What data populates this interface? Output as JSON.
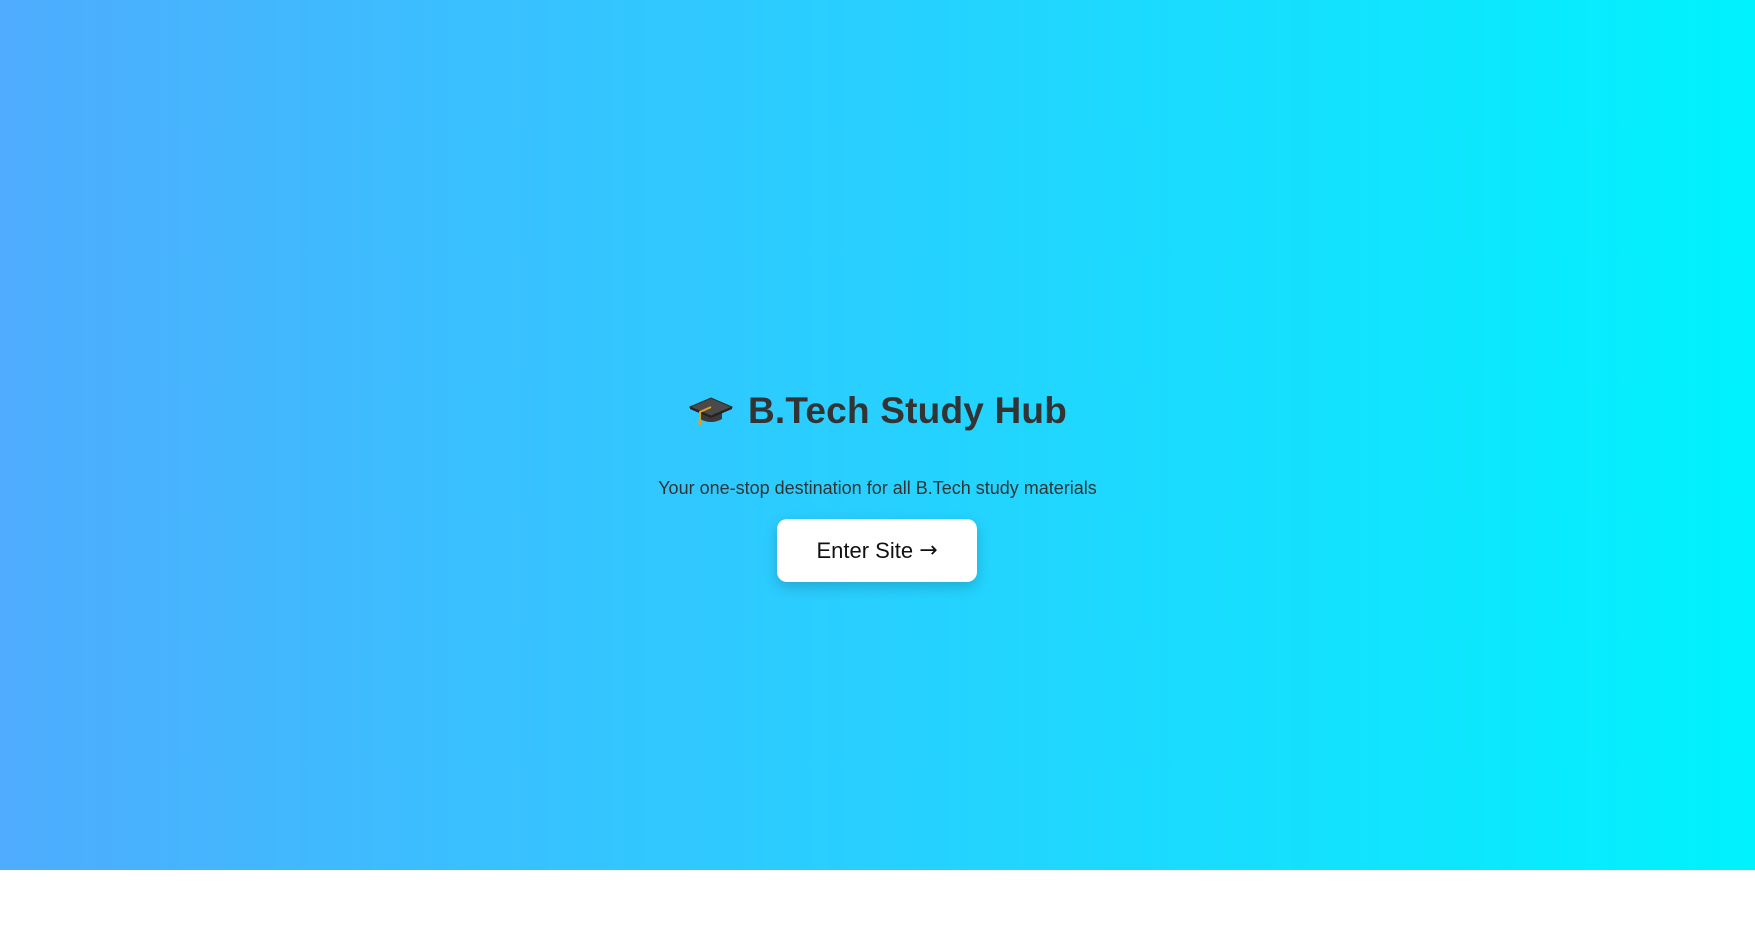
{
  "hero": {
    "icon": "graduation-cap-icon",
    "title": "B.Tech Study Hub",
    "subtitle": "Your one-stop destination for all B.Tech study materials",
    "button_label": "Enter Site",
    "button_arrow": "→",
    "colors": {
      "gradient_start": "#4facfe",
      "gradient_end": "#00f2fe",
      "text": "#333333",
      "button_bg": "#ffffff"
    }
  }
}
